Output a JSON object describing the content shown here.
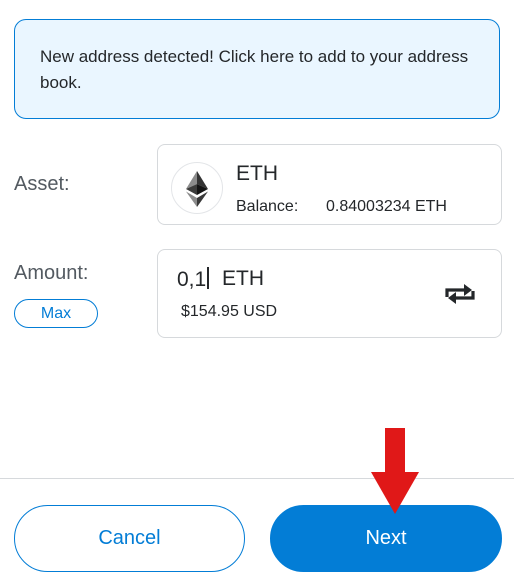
{
  "notice": {
    "text": "New address detected! Click here to add to your address book."
  },
  "form": {
    "asset_label": "Asset:",
    "amount_label": "Amount:",
    "max_label": "Max",
    "asset": {
      "symbol": "ETH",
      "balance_label": "Balance:",
      "balance_value": "0.84003234 ETH",
      "icon": "ethereum-logo-icon"
    },
    "amount": {
      "value": "0,1",
      "unit": "ETH",
      "fiat": "$154.95 USD",
      "swap_icon": "swap-arrows-icon"
    }
  },
  "footer": {
    "cancel_label": "Cancel",
    "next_label": "Next"
  },
  "colors": {
    "accent": "#037dd6",
    "notice_bg": "#eaf6ff",
    "annotation_arrow": "#e01818"
  }
}
